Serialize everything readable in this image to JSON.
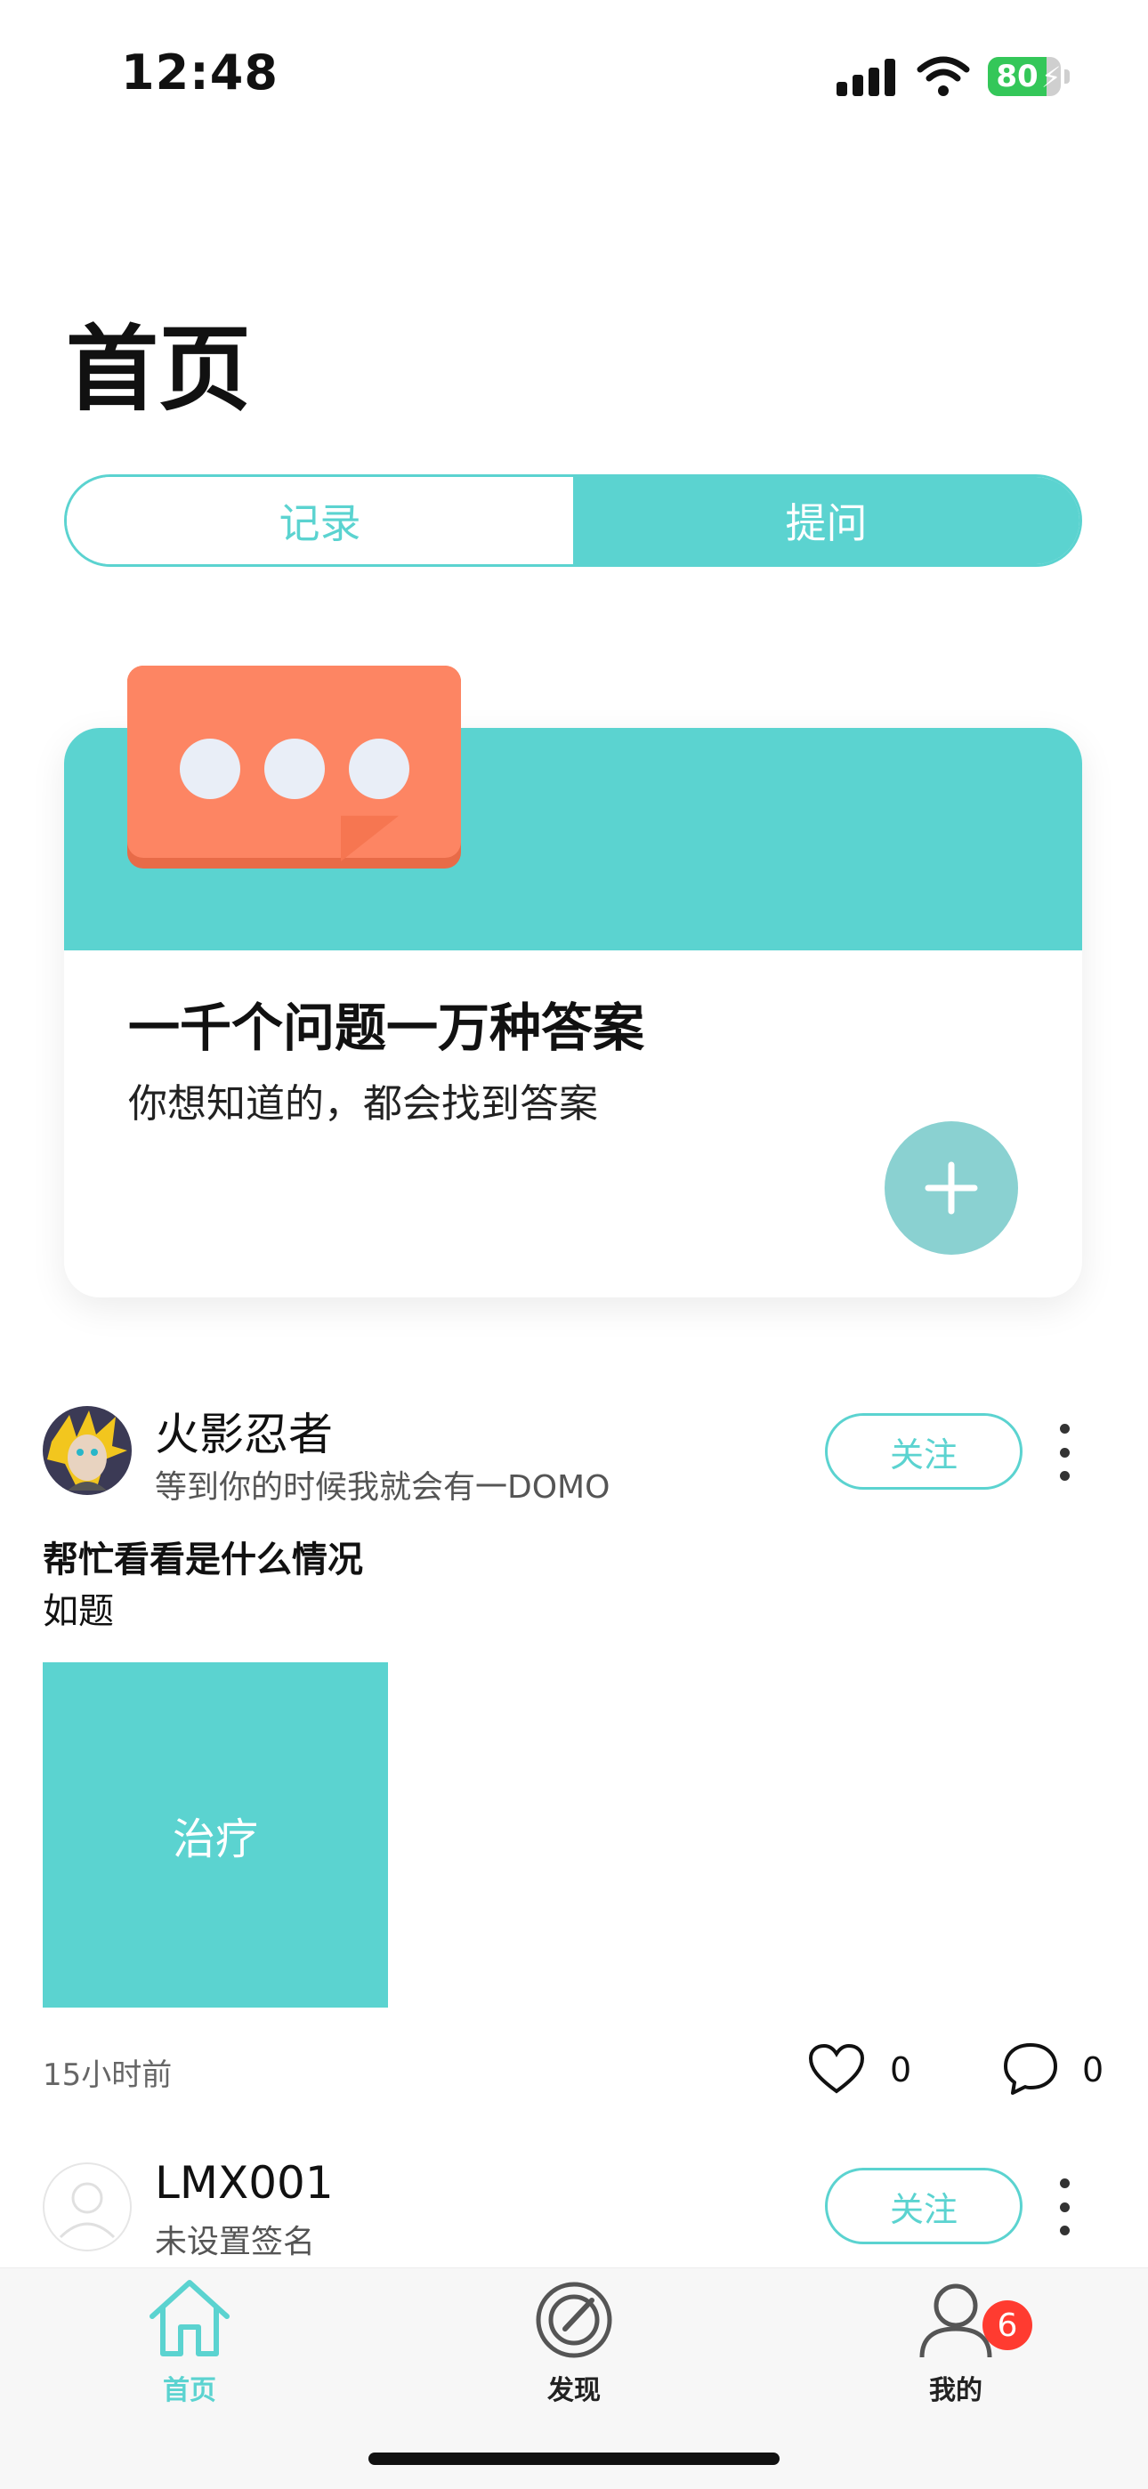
{
  "status_bar": {
    "time": "12:48",
    "battery": "80",
    "battery_level": 0.8
  },
  "page": {
    "title": "首页"
  },
  "segmented": {
    "tabs": [
      {
        "label": "记录",
        "active": false
      },
      {
        "label": "提问",
        "active": true
      }
    ]
  },
  "banner": {
    "title": "一千个问题一万种答案",
    "subtitle": "你想知道的，都会找到答案",
    "add_icon": "plus-icon"
  },
  "posts": [
    {
      "user": "火影忍者",
      "signature": "等到你的时候我就会有一DOMO",
      "follow_label": "关注",
      "title": "帮忙看看是什么情况",
      "body": "如题",
      "image_label": "治疗",
      "time": "15小时前",
      "likes": "0",
      "comments": "0"
    },
    {
      "user": "LMX001",
      "signature": "未设置签名",
      "follow_label": "关注"
    }
  ],
  "tabbar": {
    "items": [
      {
        "label": "首页",
        "icon": "home-icon",
        "active": true
      },
      {
        "label": "发现",
        "icon": "compass-icon",
        "active": false
      },
      {
        "label": "我的",
        "icon": "user-icon",
        "active": false,
        "badge": "6"
      }
    ]
  },
  "colors": {
    "accent": "#5bd3d0",
    "bubble": "#fd8563",
    "fab": "#8ad1d1",
    "badge": "#ff3b30"
  }
}
